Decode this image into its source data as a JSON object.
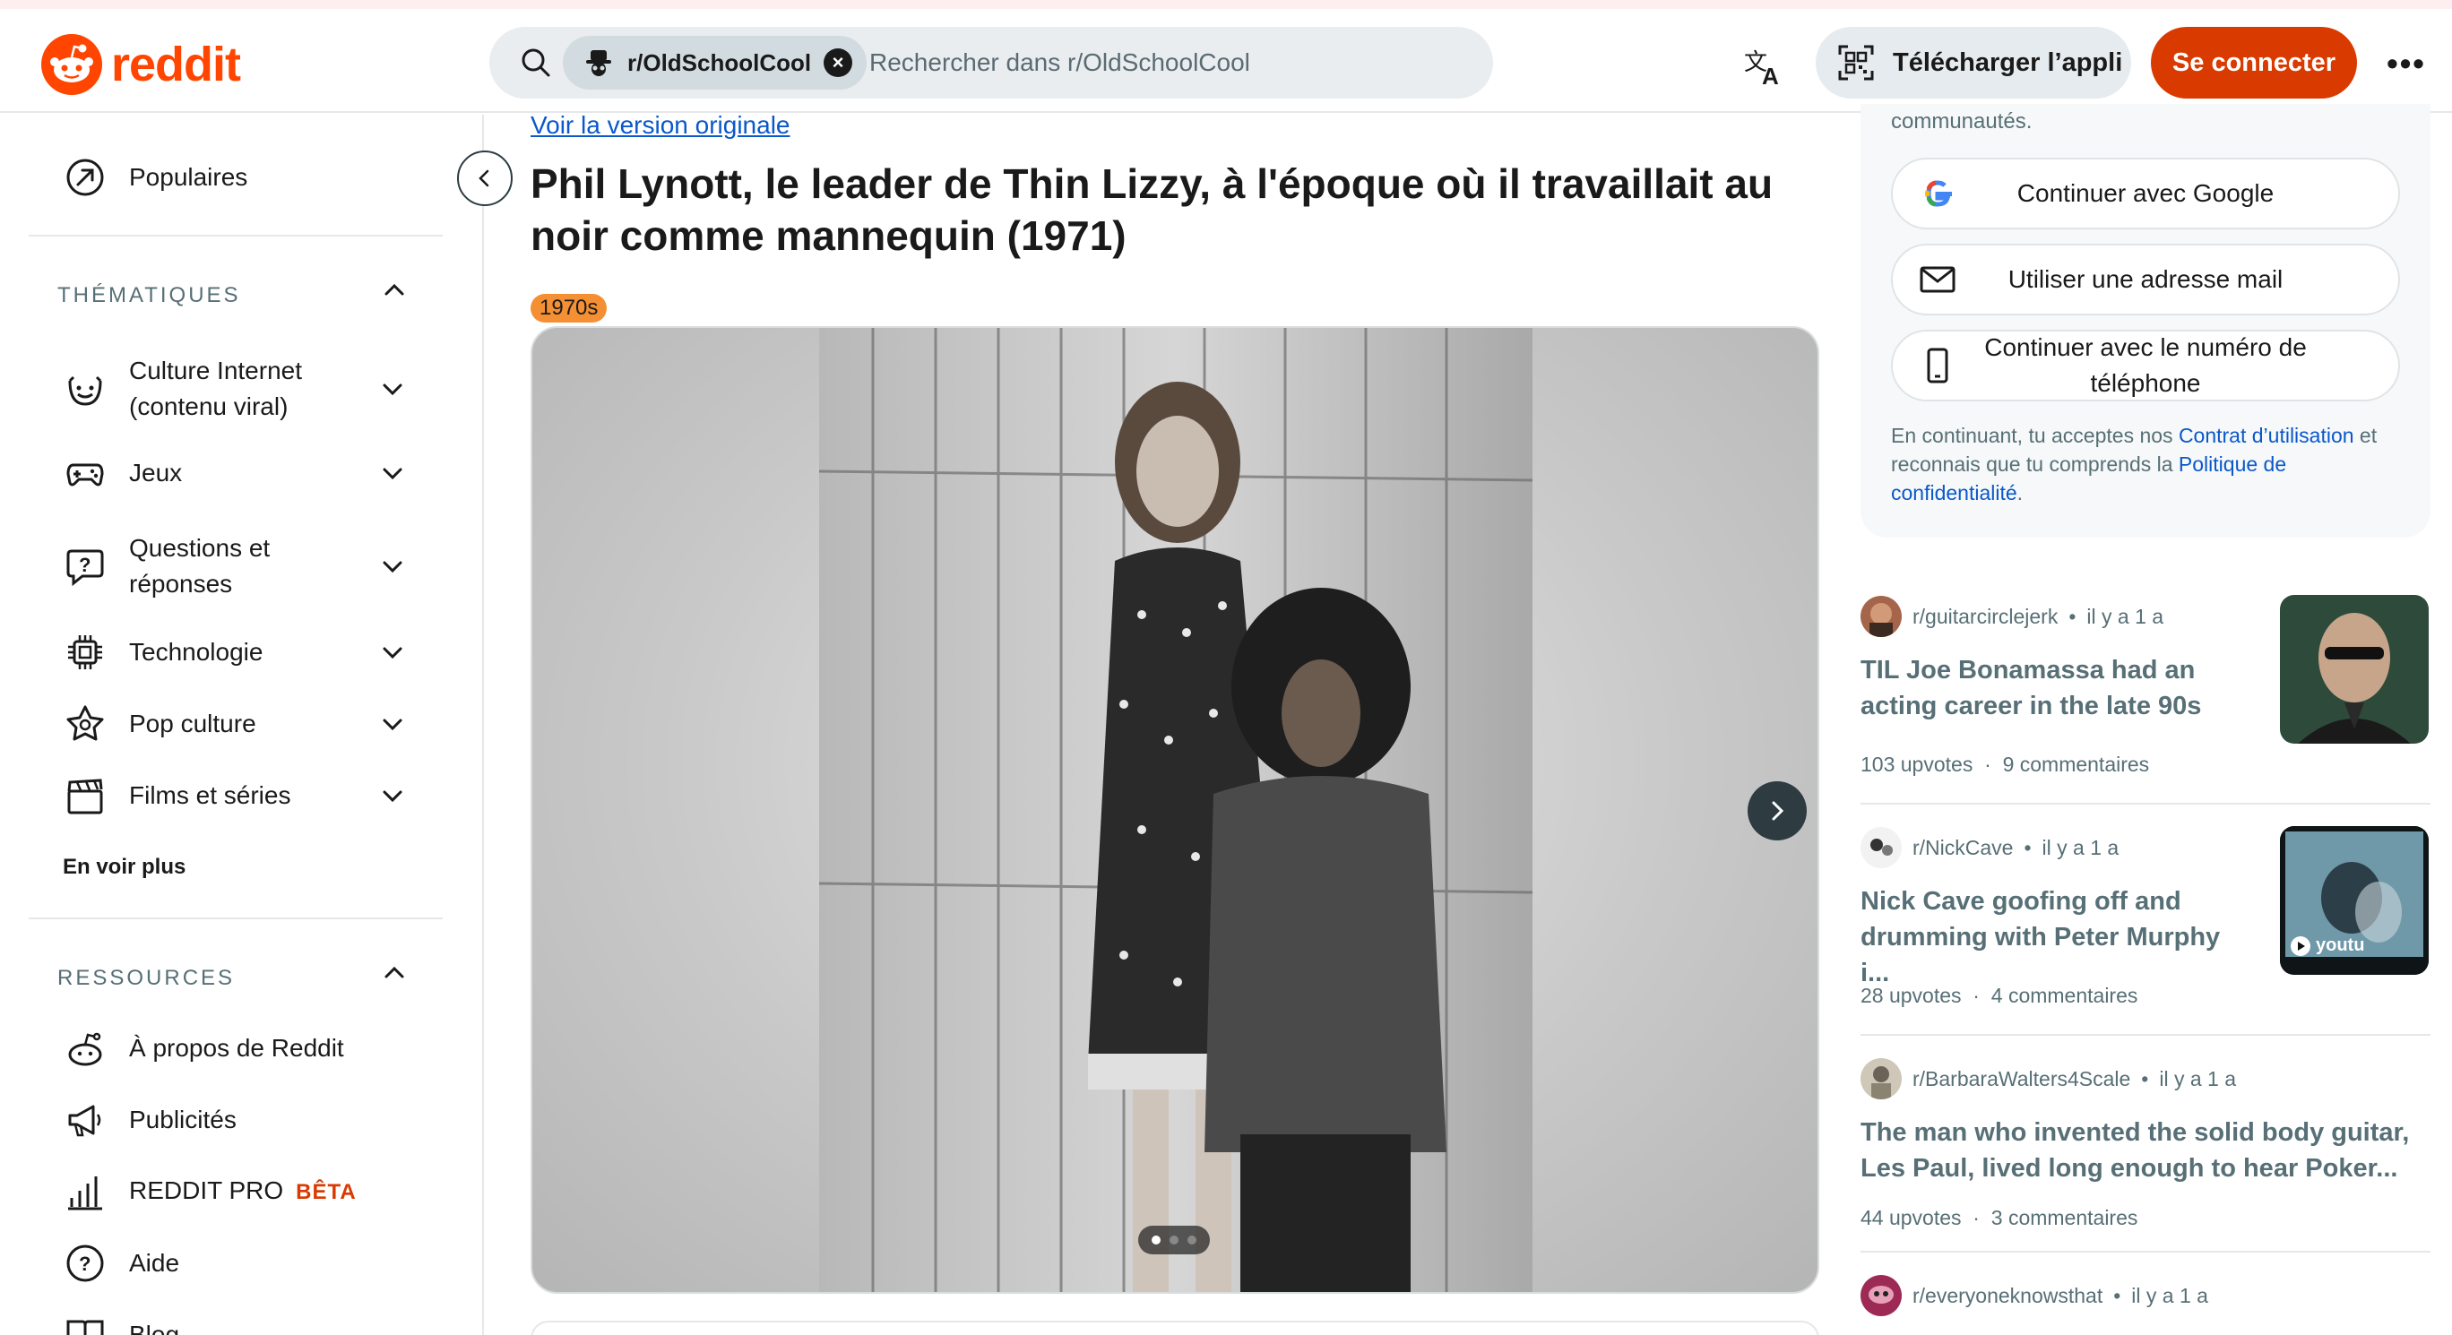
{
  "header": {
    "logo_text": "reddit",
    "search": {
      "community_chip": "r/OldSchoolCool",
      "placeholder": "Rechercher dans r/OldSchoolCool"
    },
    "app_button": "Télécharger l’appli",
    "login_button": "Se connecter",
    "more": "•••"
  },
  "sidebar": {
    "popular": "Populaires",
    "topics_title": "THÉMATIQUES",
    "topics": [
      {
        "label": "Culture Internet (contenu viral)",
        "icon": "smiley-icon"
      },
      {
        "label": "Jeux",
        "icon": "gamepad-icon"
      },
      {
        "label": "Questions et réponses",
        "icon": "question-bubble-icon"
      },
      {
        "label": "Technologie",
        "icon": "chip-icon"
      },
      {
        "label": "Pop culture",
        "icon": "star-badge-icon"
      },
      {
        "label": "Films et séries",
        "icon": "clapperboard-icon"
      }
    ],
    "see_more": "En voir plus",
    "resources_title": "RESSOURCES",
    "resources": [
      {
        "label": "À propos de Reddit",
        "icon": "reddit-alien-icon"
      },
      {
        "label": "Publicités",
        "icon": "megaphone-icon"
      },
      {
        "label": "REDDIT PRO",
        "badge": "BÊTA",
        "icon": "bar-chart-icon"
      },
      {
        "label": "Aide",
        "icon": "help-icon"
      },
      {
        "label": "Blog",
        "icon": "book-icon"
      }
    ]
  },
  "post": {
    "view_original": "Voir la version originale",
    "title": "Phil Lynott, le leader de Thin Lizzy, à l'époque où il travaillait au noir comme mannequin (1971)",
    "flair": "1970s",
    "flair_color": "#f49033",
    "carousel_count": 3,
    "carousel_active": 1
  },
  "auth": {
    "communities_text": "communautés.",
    "google": "Continuer avec Google",
    "email": "Utiliser une adresse mail",
    "phone": "Continuer avec le numéro de téléphone",
    "legal_prefix": "En continuant, tu acceptes nos ",
    "legal_link1": "Contrat d’utilisation",
    "legal_middle": " et reconnais que tu comprends la ",
    "legal_link2": "Politique de confidentialité",
    "legal_suffix": "."
  },
  "feed": [
    {
      "community": "r/guitarcirclejerk",
      "age": "il y a 1 a",
      "title": "TIL Joe Bonamassa had an acting career in the late 90s",
      "upvotes": "103 upvotes",
      "comments": "9 commentaires"
    },
    {
      "community": "r/NickCave",
      "age": "il y a 1 a",
      "title": "Nick Cave goofing off and drumming with Peter Murphy i...",
      "upvotes": "28 upvotes",
      "comments": "4 commentaires",
      "thumb_label": "youtu"
    },
    {
      "community": "r/BarbaraWalters4Scale",
      "age": "il y a 1 a",
      "title": "The man who invented the solid body guitar, Les Paul, lived long enough to hear Poker...",
      "upvotes": "44 upvotes",
      "comments": "3 commentaires"
    },
    {
      "community": "r/everyoneknowsthat",
      "age": "il y a 1 a"
    }
  ],
  "colors": {
    "brand": "#ff4500",
    "login": "#d93a00",
    "link": "#0a58ca"
  }
}
